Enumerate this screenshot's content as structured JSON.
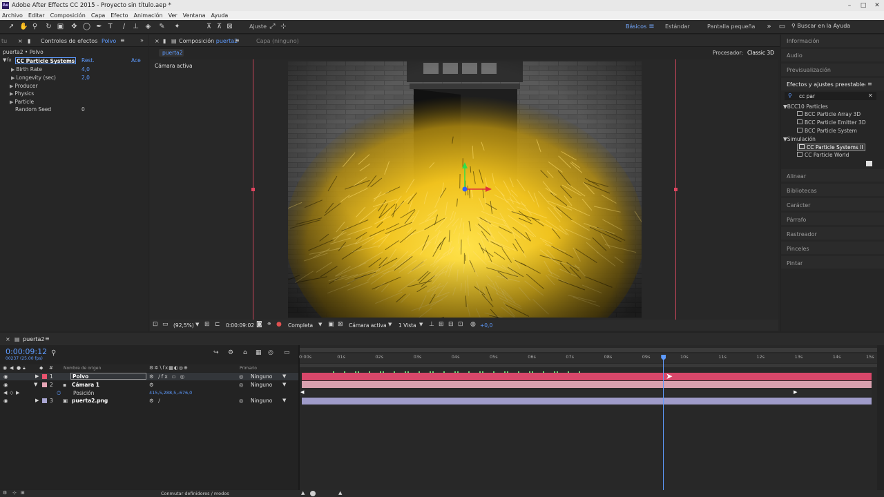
{
  "app": {
    "title": "Adobe After Effects CC 2015 - Proyecto sin título.aep *",
    "logo": "Ae"
  },
  "menu": [
    "Archivo",
    "Editar",
    "Composición",
    "Capa",
    "Efecto",
    "Animación",
    "Ver",
    "Ventana",
    "Ayuda"
  ],
  "toolbar": {
    "ajuste": "Ajuste",
    "workspaces": [
      "Básicos",
      "Estándar",
      "Pantalla pequeña"
    ],
    "active_workspace": "Básicos",
    "search_help": "Buscar en la Ayuda"
  },
  "effects_panel": {
    "tab_left": "tu",
    "tab": "Controles de efectos",
    "layer": "Polvo",
    "breadcrumb": "puerta2 • Polvo",
    "effect_name": "CC Particle Systems II",
    "reset": "Rest.",
    "about": "Ace",
    "props": [
      {
        "name": "Birth Rate",
        "value": "4,0",
        "expandable": true
      },
      {
        "name": "Longevity (sec)",
        "value": "2,0",
        "expandable": true
      },
      {
        "name": "Producer",
        "value": "",
        "expandable": true
      },
      {
        "name": "Physics",
        "value": "",
        "expandable": true
      },
      {
        "name": "Particle",
        "value": "",
        "expandable": true
      },
      {
        "name": "Random Seed",
        "value": "0",
        "expandable": false
      }
    ]
  },
  "comp_panel": {
    "tab_prefix": "Composición",
    "comp_name": "puerta2",
    "layer_tab": "Capa (ninguno)",
    "subtab": "puerta2",
    "renderer_label": "Procesador:",
    "renderer": "Classic 3D",
    "camera_label": "Cámara activa",
    "zoom": "(92,5%)",
    "timecode": "0:00:09:02",
    "resolution": "Completa",
    "view": "Cámara activa",
    "views": "1 Vista",
    "exposure": "+0,0"
  },
  "right_panel": {
    "sections_top": [
      "Información",
      "Audio",
      "Previsualización"
    ],
    "effects_title": "Efectos y ajustes preestablecidos",
    "search_value": "cc par",
    "groups": [
      {
        "name": "BCC10 Particles",
        "items": [
          "BCC Particle Array 3D",
          "BCC Particle Emitter 3D",
          "BCC Particle System"
        ]
      },
      {
        "name": "Simulación",
        "items": [
          "CC Particle Systems II",
          "CC Particle World"
        ]
      }
    ],
    "selected_item": "CC Particle Systems II",
    "sections_bottom": [
      "Alinear",
      "Bibliotecas",
      "Carácter",
      "Párrafo",
      "Rastreador",
      "Pinceles",
      "Pintar"
    ]
  },
  "timeline": {
    "tab": "puerta2",
    "timecode": "0:00:09:12",
    "frames": "00237 (25.00 fps)",
    "col_source": "Nombre de origen",
    "col_parent": "Primario",
    "layers": [
      {
        "num": "1",
        "name": "Polvo",
        "parent": "Ninguno",
        "color": "#e8536e"
      },
      {
        "num": "2",
        "name": "Cámara 1",
        "parent": "Ninguno",
        "color": "#e8a6b6"
      },
      {
        "num": "3",
        "name": "puerta2.png",
        "parent": "Ninguno",
        "color": "#a9a6d2"
      }
    ],
    "position_label": "Posición",
    "position_value": "415,5,288,5,-676,0",
    "ruler": [
      "0:00s",
      "01s",
      "02s",
      "03s",
      "04s",
      "05s",
      "06s",
      "07s",
      "08s",
      "09s",
      "10s",
      "11s",
      "12s",
      "13s",
      "14s",
      "15s"
    ],
    "playhead_seconds": 9.48,
    "toggle_label": "Conmutar definidores / modos"
  },
  "colors": {
    "accent": "#5e9bff",
    "layer_red": "#d8476a",
    "layer_pink": "#d9a0ae",
    "layer_lavender": "#9f9bc9",
    "guide_red": "#c9465a",
    "particle_yellow": "#f0c21e"
  }
}
